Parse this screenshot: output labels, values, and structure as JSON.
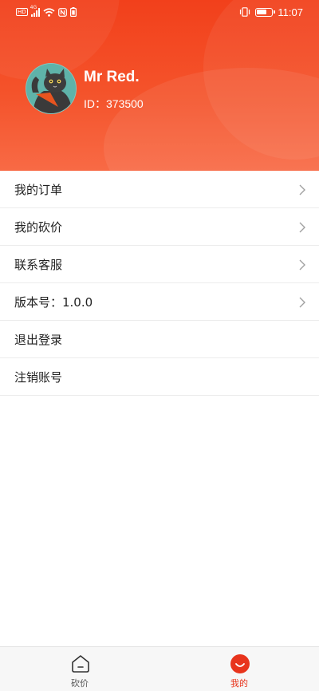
{
  "status_bar": {
    "time": "11:07",
    "network": "4G",
    "hd_label": "HD",
    "battery_level": 0.7,
    "icons": [
      "hd-icon",
      "signal-icon",
      "wifi-icon",
      "nfc-icon",
      "battery-saver-icon",
      "vibrate-icon",
      "battery-icon"
    ]
  },
  "profile": {
    "name": "Mr Red.",
    "id_text": "ID：373500",
    "avatar_icon": "cat-avatar"
  },
  "menu": {
    "items": [
      {
        "label": "我的订单",
        "chevron": true
      },
      {
        "label": "我的砍价",
        "chevron": true
      },
      {
        "label": "联系客服",
        "chevron": true
      },
      {
        "label": "版本号：1.0.0",
        "chevron": true
      },
      {
        "label": "退出登录",
        "chevron": false
      },
      {
        "label": "注销账号",
        "chevron": false
      }
    ]
  },
  "tabbar": {
    "tabs": [
      {
        "label": "砍价",
        "icon": "home-icon",
        "active": false
      },
      {
        "label": "我的",
        "icon": "smile-icon",
        "active": true
      }
    ]
  },
  "colors": {
    "header_top": "#f2401b",
    "header_bottom": "#f86a45",
    "accent": "#e8341c",
    "text": "#222222"
  }
}
